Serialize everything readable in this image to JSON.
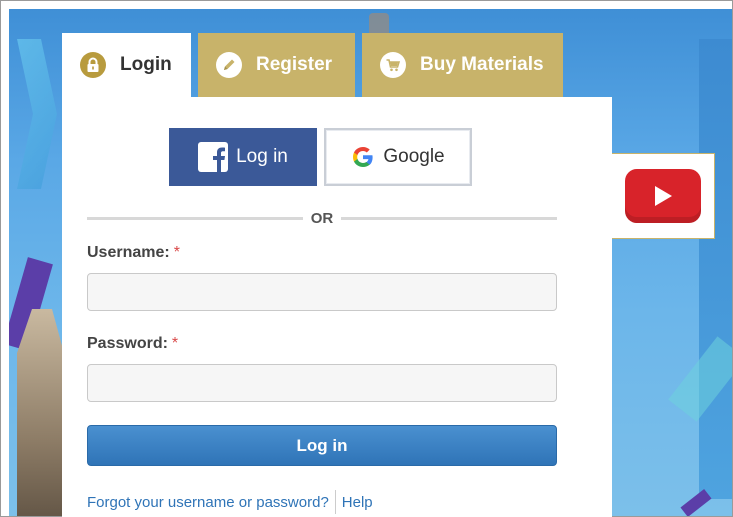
{
  "tabs": {
    "login": {
      "label": "Login",
      "icon": "lock-icon"
    },
    "register": {
      "label": "Register",
      "icon": "pencil-icon"
    },
    "buy": {
      "label": "Buy Materials",
      "icon": "shopping-cart-icon"
    }
  },
  "social": {
    "facebook": {
      "label": "Log in",
      "icon": "facebook-icon"
    },
    "google": {
      "label": "Google",
      "icon": "google-icon"
    }
  },
  "divider": {
    "text": "OR"
  },
  "form": {
    "username": {
      "label": "Username:",
      "required_mark": "*",
      "value": ""
    },
    "password": {
      "label": "Password:",
      "required_mark": "*",
      "value": ""
    },
    "submit_label": "Log in"
  },
  "links": {
    "forgot": "Forgot your username or password?",
    "help": "Help"
  },
  "video": {
    "icon": "youtube-play-icon"
  },
  "colors": {
    "tab_gold": "#c8b36a",
    "facebook_blue": "#3b5998",
    "primary_blue": "#2f74b7",
    "youtube_red": "#d8232a",
    "required_red": "#d94848"
  }
}
